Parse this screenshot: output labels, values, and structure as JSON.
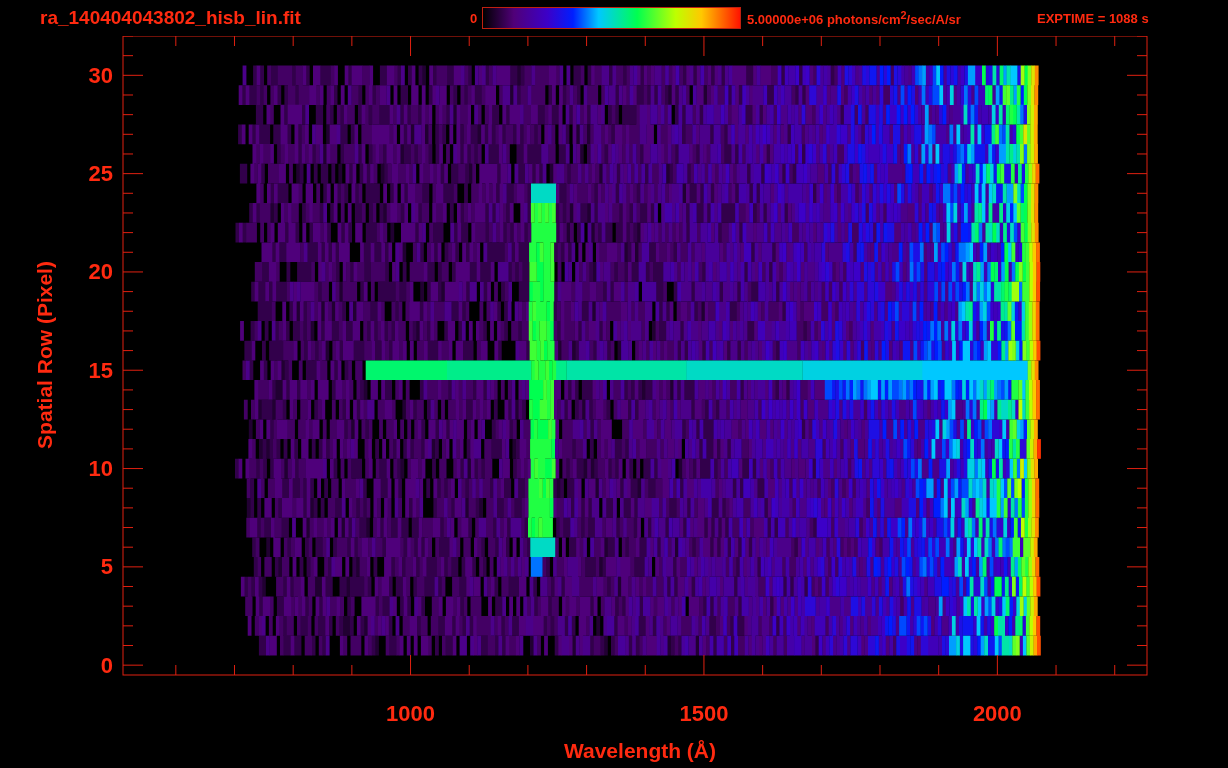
{
  "title": "ra_140404043802_hisb_lin.fit",
  "colorbar": {
    "min_label": "0",
    "max_label": "5.00000e+06 photons/cm$^{2}$/sec/A/sr"
  },
  "exposure": "EXPTIME = 1088 s",
  "plot": {
    "xlabel": "Wavelength (Å)",
    "ylabel": "Spatial Row (Pixel)",
    "x_tick_labels": [
      "1000",
      "1500",
      "2000"
    ],
    "y_tick_labels": [
      "30",
      "25",
      "20",
      "15",
      "10",
      "5",
      "0"
    ]
  }
}
